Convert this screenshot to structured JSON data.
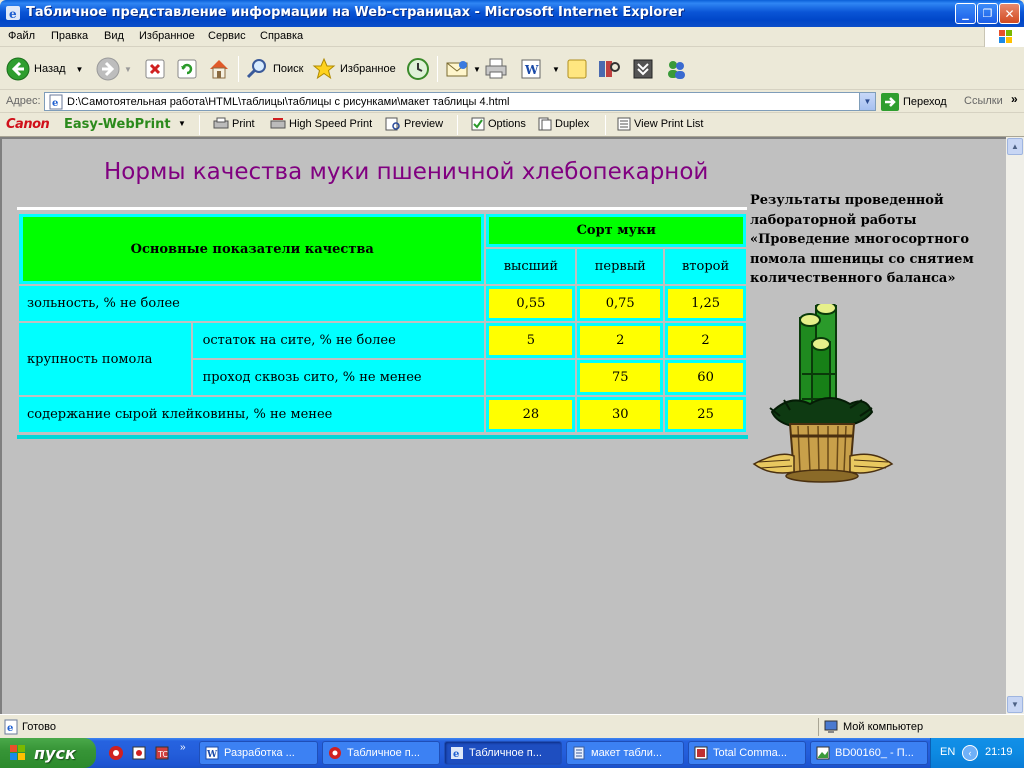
{
  "window": {
    "title": "Табличное представление информации на Web-страницах - Microsoft Internet Explorer",
    "minimize": "_",
    "maximize": "❐",
    "close": "✕"
  },
  "menu": [
    "Файл",
    "Правка",
    "Вид",
    "Избранное",
    "Сервис",
    "Справка"
  ],
  "toolbar": {
    "back_label": "Назад",
    "search_label": "Поиск",
    "favorites_label": "Избранное"
  },
  "address": {
    "label": "Адрес:",
    "value": "D:\\Самотоятельная работа\\HTML\\таблицы\\таблицы с рисунками\\макет таблицы 4.html",
    "go_label": "Переход",
    "links_label": "Ссылки"
  },
  "canon_bar": {
    "brand": "Canon",
    "product": "Easy-WebPrint",
    "print_label": "Print",
    "high_speed_label": "High Speed Print",
    "preview_label": "Preview",
    "options_label": "Options",
    "duplex_label": "Duplex",
    "view_list_label": "View Print List"
  },
  "page": {
    "title": "Нормы качества муки пшеничной хлебопекарной",
    "table": {
      "header_main": "Основные показатели качества",
      "header_sort": "Сорт муки",
      "grades": [
        "высший",
        "первый",
        "второй"
      ],
      "rows": [
        {
          "label": "зольность, % не более",
          "values": [
            "0,55",
            "0,75",
            "1,25"
          ]
        },
        {
          "label": "крупность помола",
          "sub": "остаток на сите, % не более",
          "values": [
            "5",
            "2",
            "2"
          ]
        },
        {
          "sub": "проход сквозь сито, % не менее",
          "values": [
            "",
            "75",
            "60"
          ]
        },
        {
          "label": "содержание сырой клейковины, % не менее",
          "values": [
            "28",
            "30",
            "25"
          ]
        }
      ]
    },
    "side_text": "Результаты проведенной лабораторной работы «Проведение многосортного помола пшеницы со снятием количественного баланса»"
  },
  "status": {
    "left": "Готово",
    "zone": "Мой компьютер"
  },
  "taskbar": {
    "start_label": "пуск",
    "tasks": [
      "Разработка ...",
      "Табличное п...",
      "Табличное п...",
      "макет табли...",
      "Total Comma...",
      "BD00160_ - П..."
    ],
    "lang": "EN",
    "time": "21:19"
  },
  "colors": {
    "header_green": "#00ff00",
    "cell_cyan": "#00ffff",
    "value_yellow": "#ffff00",
    "title_purple": "#800080",
    "page_bg": "#c0c0c0"
  }
}
